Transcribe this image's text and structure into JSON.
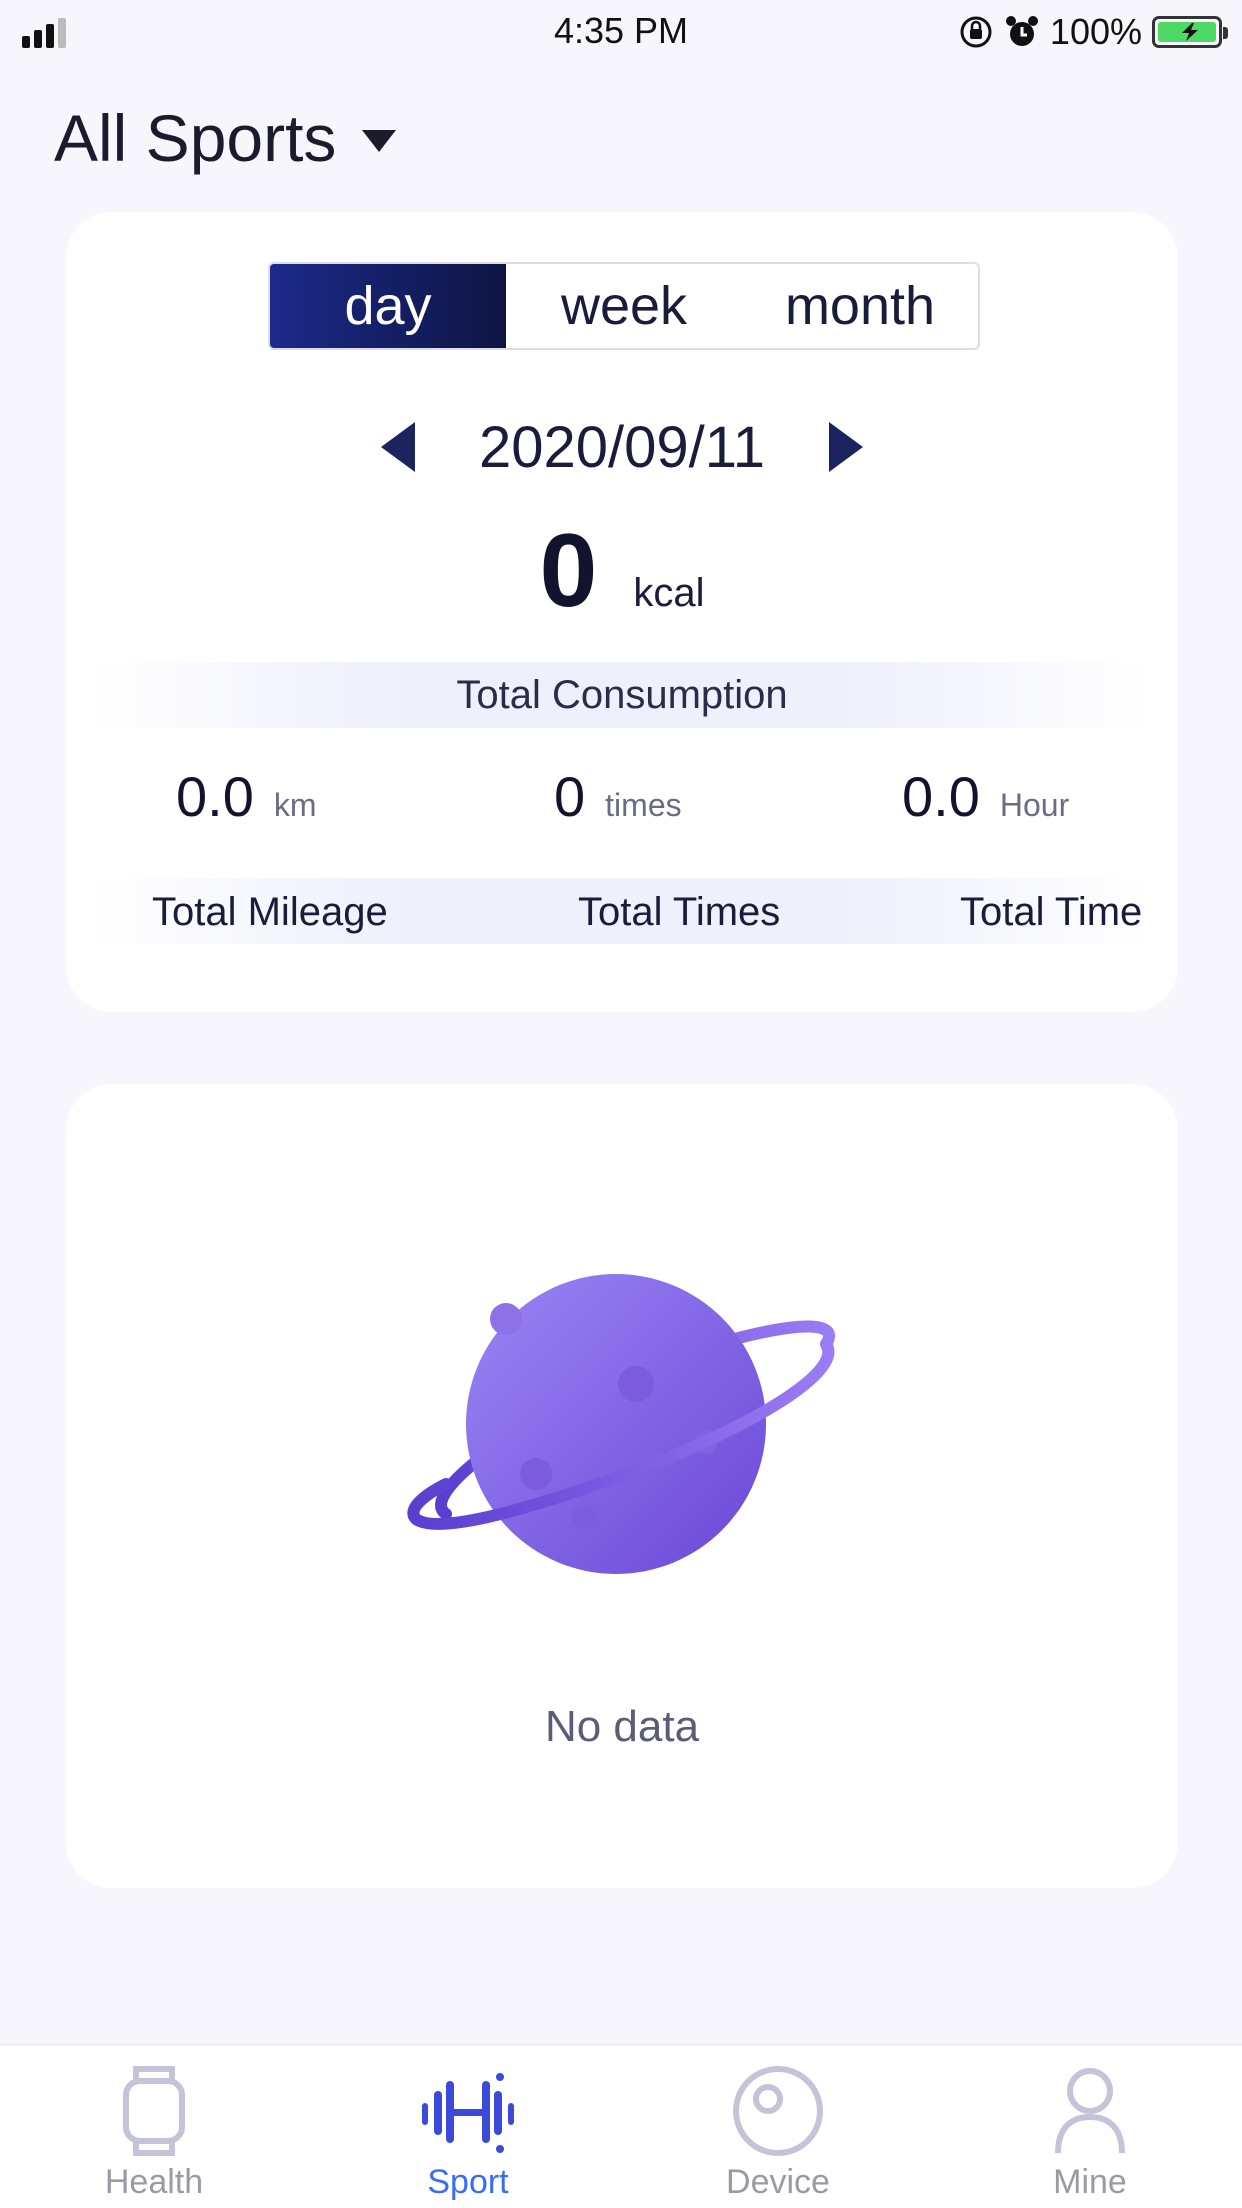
{
  "status_bar": {
    "time": "4:35 PM",
    "battery_percent": "100%",
    "icons": [
      "signal-icon",
      "rotation-lock-icon",
      "alarm-icon",
      "battery-charging-icon"
    ]
  },
  "header": {
    "title": "All Sports",
    "dropdown_icon": "caret-down-icon"
  },
  "summary": {
    "tabs": [
      "day",
      "week",
      "month"
    ],
    "active_tab": "day",
    "date": "2020/09/11",
    "kcal_value": "0",
    "kcal_unit": "kcal",
    "consumption_label": "Total Consumption",
    "stats": [
      {
        "value": "0.0",
        "unit": "km",
        "label": "Total Mileage"
      },
      {
        "value": "0",
        "unit": "times",
        "label": "Total Times"
      },
      {
        "value": "0.0",
        "unit": "Hour",
        "label": "Total Time"
      }
    ]
  },
  "empty_state": {
    "illustration": "planet-illustration",
    "message": "No data"
  },
  "tab_bar": {
    "items": [
      {
        "label": "Health",
        "icon": "watch-icon"
      },
      {
        "label": "Sport",
        "icon": "dumbbell-icon"
      },
      {
        "label": "Device",
        "icon": "device-icon"
      },
      {
        "label": "Mine",
        "icon": "person-icon"
      }
    ],
    "active": "Sport"
  },
  "colors": {
    "background": "#f6f6fc",
    "card": "#ffffff",
    "segment_active": "#1c2a8a",
    "tab_active": "#3b6cf6",
    "tab_inactive": "#9a9aa6",
    "planet": "#8a6cf0"
  }
}
